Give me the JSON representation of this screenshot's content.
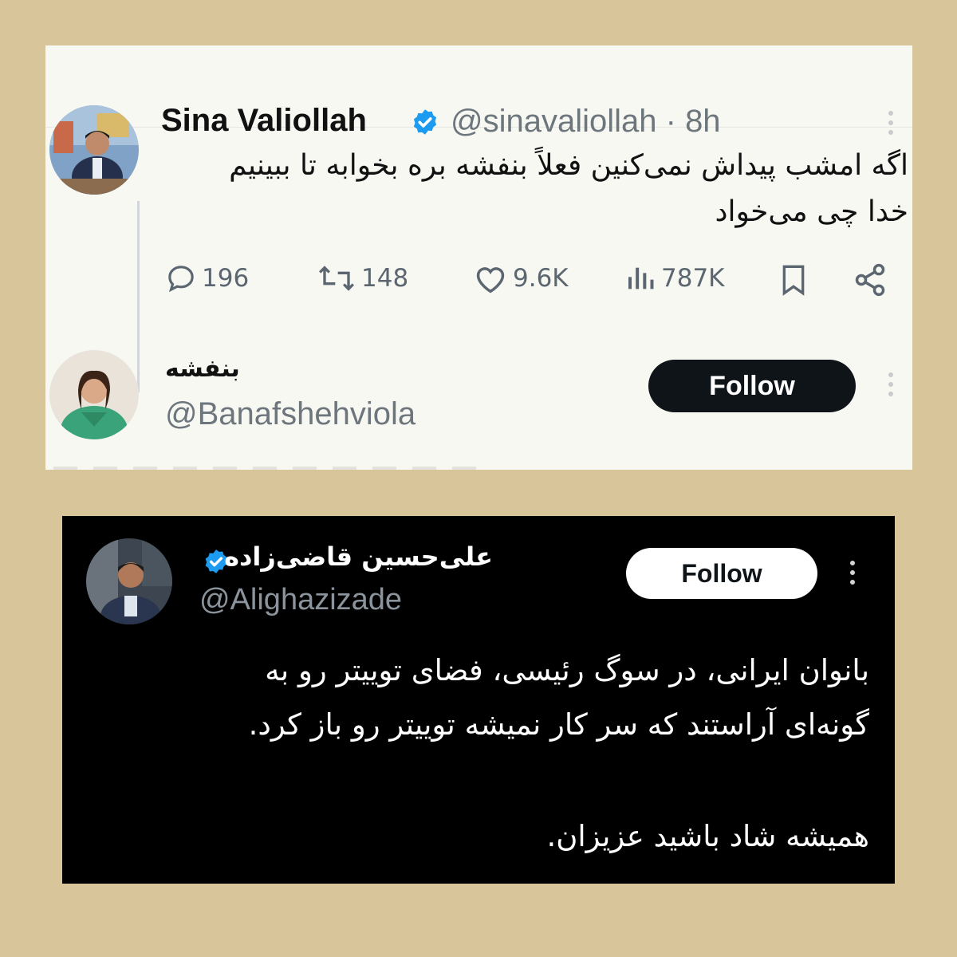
{
  "tweet1": {
    "author_name": "Sina Valiollah",
    "handle_time": "@sinavaliollah · 8h",
    "text_line1": "اگه امشب پیداش نمی‌کنین فعلاً بنفشه بره بخوابه تا ببینیم",
    "text_line2": "خدا چی می‌خواد",
    "stats": {
      "replies": "196",
      "retweets": "148",
      "likes": "9.6K",
      "views": "787K"
    },
    "colors": {
      "verified": "#1d9bf0",
      "follow_bg": "#0f1419"
    }
  },
  "reply_account": {
    "name": "بنفشه",
    "handle": "@Banafshehviola",
    "follow_label": "Follow"
  },
  "tweet2": {
    "author_name": "علی‌حسین قاضی‌زاده",
    "handle": "@Alighazizade",
    "follow_label": "Follow",
    "text_line1": "بانوان ایرانی، در سوگ رئیسی، فضای توییتر رو به",
    "text_line2": "گونه‌ای آراستند که سر کار نمیشه توییتر رو باز کرد.",
    "text_line3": "همیشه شاد باشید عزیزان.",
    "colors": {
      "background": "#000000",
      "verified": "#1d9bf0"
    }
  },
  "icons": [
    "reply-icon",
    "retweet-icon",
    "like-icon",
    "views-icon",
    "bookmark-icon",
    "share-icon",
    "verified-icon",
    "more-icon"
  ],
  "page": {
    "background": "#d8c69a"
  }
}
